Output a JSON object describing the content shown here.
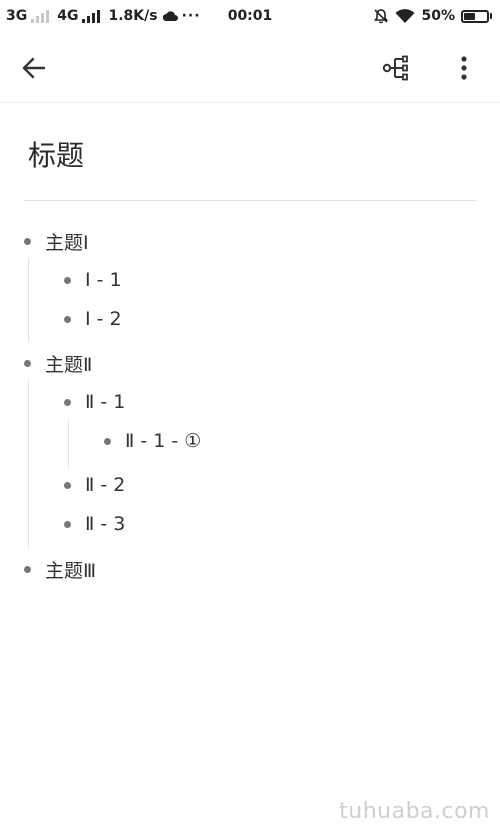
{
  "status_bar": {
    "network1": "3G",
    "network2": "4G",
    "speed": "1.8K/s",
    "more": "···",
    "time": "00:01",
    "battery_text": "50%",
    "battery_level": 0.5
  },
  "app_bar": {
    "back_icon": "arrow-left-icon",
    "mindmap_icon": "mind-map-icon",
    "more_icon": "more-vertical-icon"
  },
  "document": {
    "title": "标题"
  },
  "outline": [
    {
      "text": "主题Ⅰ"
    },
    {
      "text": "Ⅰ - 1"
    },
    {
      "text": "Ⅰ - 2"
    },
    {
      "text": "主题Ⅱ"
    },
    {
      "text": "Ⅱ - 1"
    },
    {
      "text": "Ⅱ - 1 - ①"
    },
    {
      "text": "Ⅱ - 2"
    },
    {
      "text": "Ⅱ - 3"
    },
    {
      "text": "主题Ⅲ"
    }
  ],
  "watermark": "tuhuaba.com",
  "colors": {
    "text": "#333333",
    "bullet": "#777777",
    "divider": "#e0e0e0"
  }
}
